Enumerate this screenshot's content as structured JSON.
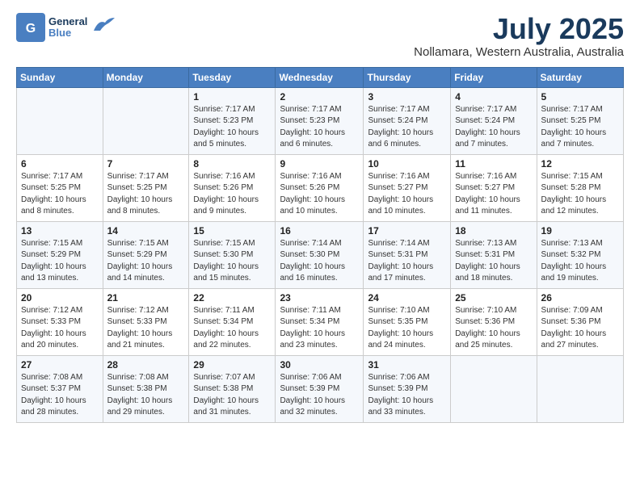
{
  "logo": {
    "general": "General",
    "blue": "Blue"
  },
  "header": {
    "month": "July 2025",
    "location": "Nollamara, Western Australia, Australia"
  },
  "weekdays": [
    "Sunday",
    "Monday",
    "Tuesday",
    "Wednesday",
    "Thursday",
    "Friday",
    "Saturday"
  ],
  "weeks": [
    [
      {
        "day": "",
        "info": ""
      },
      {
        "day": "",
        "info": ""
      },
      {
        "day": "1",
        "info": "Sunrise: 7:17 AM\nSunset: 5:23 PM\nDaylight: 10 hours\nand 5 minutes."
      },
      {
        "day": "2",
        "info": "Sunrise: 7:17 AM\nSunset: 5:23 PM\nDaylight: 10 hours\nand 6 minutes."
      },
      {
        "day": "3",
        "info": "Sunrise: 7:17 AM\nSunset: 5:24 PM\nDaylight: 10 hours\nand 6 minutes."
      },
      {
        "day": "4",
        "info": "Sunrise: 7:17 AM\nSunset: 5:24 PM\nDaylight: 10 hours\nand 7 minutes."
      },
      {
        "day": "5",
        "info": "Sunrise: 7:17 AM\nSunset: 5:25 PM\nDaylight: 10 hours\nand 7 minutes."
      }
    ],
    [
      {
        "day": "6",
        "info": "Sunrise: 7:17 AM\nSunset: 5:25 PM\nDaylight: 10 hours\nand 8 minutes."
      },
      {
        "day": "7",
        "info": "Sunrise: 7:17 AM\nSunset: 5:25 PM\nDaylight: 10 hours\nand 8 minutes."
      },
      {
        "day": "8",
        "info": "Sunrise: 7:16 AM\nSunset: 5:26 PM\nDaylight: 10 hours\nand 9 minutes."
      },
      {
        "day": "9",
        "info": "Sunrise: 7:16 AM\nSunset: 5:26 PM\nDaylight: 10 hours\nand 10 minutes."
      },
      {
        "day": "10",
        "info": "Sunrise: 7:16 AM\nSunset: 5:27 PM\nDaylight: 10 hours\nand 10 minutes."
      },
      {
        "day": "11",
        "info": "Sunrise: 7:16 AM\nSunset: 5:27 PM\nDaylight: 10 hours\nand 11 minutes."
      },
      {
        "day": "12",
        "info": "Sunrise: 7:15 AM\nSunset: 5:28 PM\nDaylight: 10 hours\nand 12 minutes."
      }
    ],
    [
      {
        "day": "13",
        "info": "Sunrise: 7:15 AM\nSunset: 5:29 PM\nDaylight: 10 hours\nand 13 minutes."
      },
      {
        "day": "14",
        "info": "Sunrise: 7:15 AM\nSunset: 5:29 PM\nDaylight: 10 hours\nand 14 minutes."
      },
      {
        "day": "15",
        "info": "Sunrise: 7:15 AM\nSunset: 5:30 PM\nDaylight: 10 hours\nand 15 minutes."
      },
      {
        "day": "16",
        "info": "Sunrise: 7:14 AM\nSunset: 5:30 PM\nDaylight: 10 hours\nand 16 minutes."
      },
      {
        "day": "17",
        "info": "Sunrise: 7:14 AM\nSunset: 5:31 PM\nDaylight: 10 hours\nand 17 minutes."
      },
      {
        "day": "18",
        "info": "Sunrise: 7:13 AM\nSunset: 5:31 PM\nDaylight: 10 hours\nand 18 minutes."
      },
      {
        "day": "19",
        "info": "Sunrise: 7:13 AM\nSunset: 5:32 PM\nDaylight: 10 hours\nand 19 minutes."
      }
    ],
    [
      {
        "day": "20",
        "info": "Sunrise: 7:12 AM\nSunset: 5:33 PM\nDaylight: 10 hours\nand 20 minutes."
      },
      {
        "day": "21",
        "info": "Sunrise: 7:12 AM\nSunset: 5:33 PM\nDaylight: 10 hours\nand 21 minutes."
      },
      {
        "day": "22",
        "info": "Sunrise: 7:11 AM\nSunset: 5:34 PM\nDaylight: 10 hours\nand 22 minutes."
      },
      {
        "day": "23",
        "info": "Sunrise: 7:11 AM\nSunset: 5:34 PM\nDaylight: 10 hours\nand 23 minutes."
      },
      {
        "day": "24",
        "info": "Sunrise: 7:10 AM\nSunset: 5:35 PM\nDaylight: 10 hours\nand 24 minutes."
      },
      {
        "day": "25",
        "info": "Sunrise: 7:10 AM\nSunset: 5:36 PM\nDaylight: 10 hours\nand 25 minutes."
      },
      {
        "day": "26",
        "info": "Sunrise: 7:09 AM\nSunset: 5:36 PM\nDaylight: 10 hours\nand 27 minutes."
      }
    ],
    [
      {
        "day": "27",
        "info": "Sunrise: 7:08 AM\nSunset: 5:37 PM\nDaylight: 10 hours\nand 28 minutes."
      },
      {
        "day": "28",
        "info": "Sunrise: 7:08 AM\nSunset: 5:38 PM\nDaylight: 10 hours\nand 29 minutes."
      },
      {
        "day": "29",
        "info": "Sunrise: 7:07 AM\nSunset: 5:38 PM\nDaylight: 10 hours\nand 31 minutes."
      },
      {
        "day": "30",
        "info": "Sunrise: 7:06 AM\nSunset: 5:39 PM\nDaylight: 10 hours\nand 32 minutes."
      },
      {
        "day": "31",
        "info": "Sunrise: 7:06 AM\nSunset: 5:39 PM\nDaylight: 10 hours\nand 33 minutes."
      },
      {
        "day": "",
        "info": ""
      },
      {
        "day": "",
        "info": ""
      }
    ]
  ]
}
